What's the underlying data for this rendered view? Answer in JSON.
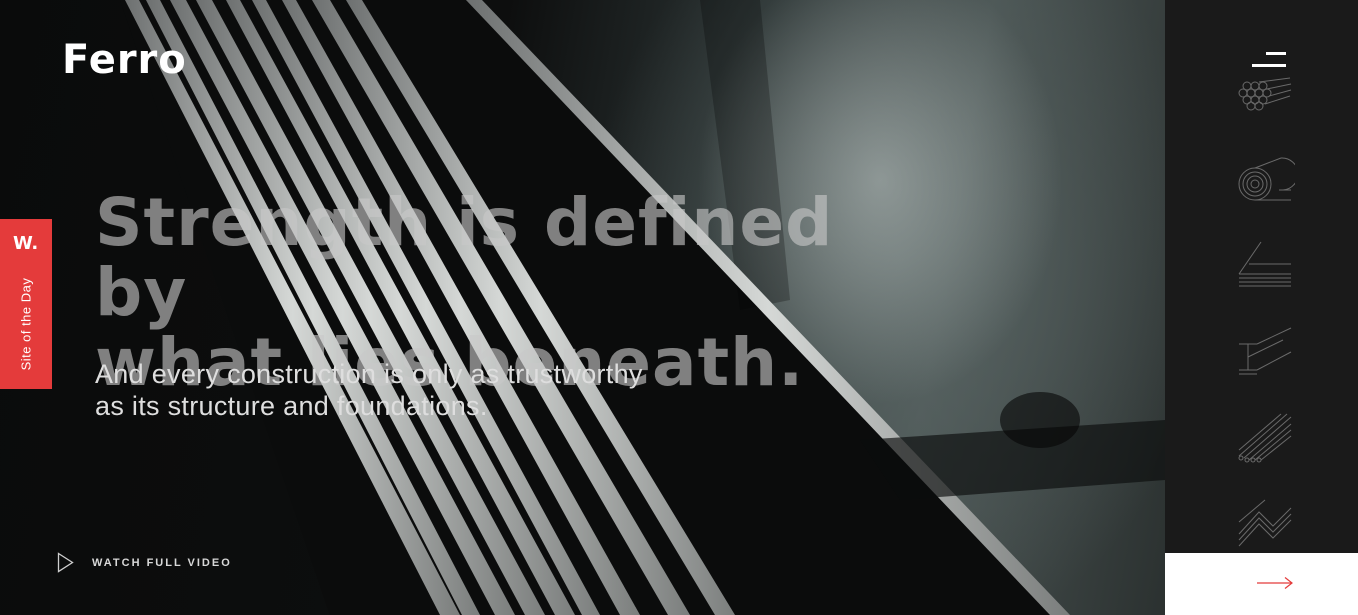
{
  "brand": {
    "logo": "Ferro"
  },
  "hero": {
    "headline_line1": "Strength is defined by",
    "headline_line2": "what lies beneath.",
    "subline_line1": "And every construction is only as trustworthy",
    "subline_line2": "as its structure and foundations."
  },
  "badge": {
    "mark": "W.",
    "label": "Site of the Day",
    "color": "#e43b3b"
  },
  "video": {
    "label": "WATCH FULL VIDEO",
    "icon": "play-icon"
  },
  "sidebar": {
    "menu_icon": "hamburger-menu-icon",
    "categories": [
      {
        "icon": "rebar-bundle-icon"
      },
      {
        "icon": "steel-coil-icon"
      },
      {
        "icon": "steel-sheet-icon"
      },
      {
        "icon": "i-beam-icon"
      },
      {
        "icon": "steel-rods-icon"
      },
      {
        "icon": "mesh-icon"
      }
    ],
    "next_icon": "arrow-right-icon",
    "accent": "#e43b3b"
  }
}
